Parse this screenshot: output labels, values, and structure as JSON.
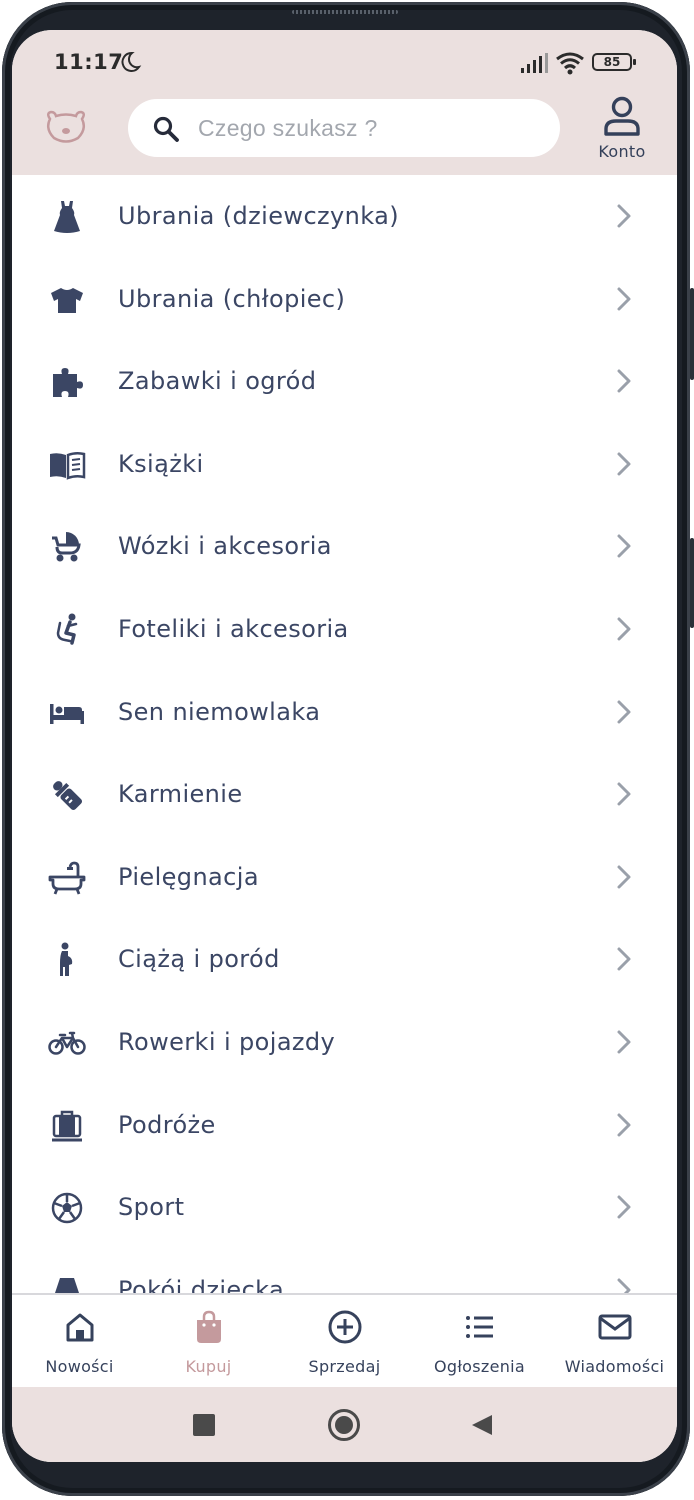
{
  "status_bar": {
    "time": "11:17",
    "battery": "85"
  },
  "header": {
    "search_placeholder": "Czego szukasz ?",
    "account_label": "Konto"
  },
  "categories": [
    {
      "label": "Ubrania (dziewczynka)",
      "icon": "dress-icon"
    },
    {
      "label": "Ubrania (chłopiec)",
      "icon": "tshirt-icon"
    },
    {
      "label": "Zabawki i ogród",
      "icon": "puzzle-icon"
    },
    {
      "label": "Książki",
      "icon": "book-icon"
    },
    {
      "label": "Wózki i akcesoria",
      "icon": "stroller-icon"
    },
    {
      "label": "Foteliki i akcesoria",
      "icon": "car-seat-icon"
    },
    {
      "label": "Sen niemowlaka",
      "icon": "bed-icon"
    },
    {
      "label": "Karmienie",
      "icon": "baby-bottle-icon"
    },
    {
      "label": "Pielęgnacja",
      "icon": "bathtub-icon"
    },
    {
      "label": "Ciążą i poród",
      "icon": "pregnancy-icon"
    },
    {
      "label": "Rowerki i pojazdy",
      "icon": "bicycle-icon"
    },
    {
      "label": "Podróże",
      "icon": "luggage-icon"
    },
    {
      "label": "Sport",
      "icon": "football-icon"
    },
    {
      "label": "Pokój dziecka",
      "icon": "lamp-icon"
    }
  ],
  "bottom_nav": [
    {
      "label": "Nowości",
      "icon": "home-icon",
      "active": false
    },
    {
      "label": "Kupuj",
      "icon": "shopping-bag-icon",
      "active": true
    },
    {
      "label": "Sprzedaj",
      "icon": "plus-circle-icon",
      "active": false
    },
    {
      "label": "Ogłoszenia",
      "icon": "list-icon",
      "active": false
    },
    {
      "label": "Wiadomości",
      "icon": "envelope-icon",
      "active": false
    }
  ],
  "colors": {
    "header_bg": "#ebe0df",
    "text": "#3b4664",
    "accent": "#c49a9d"
  }
}
